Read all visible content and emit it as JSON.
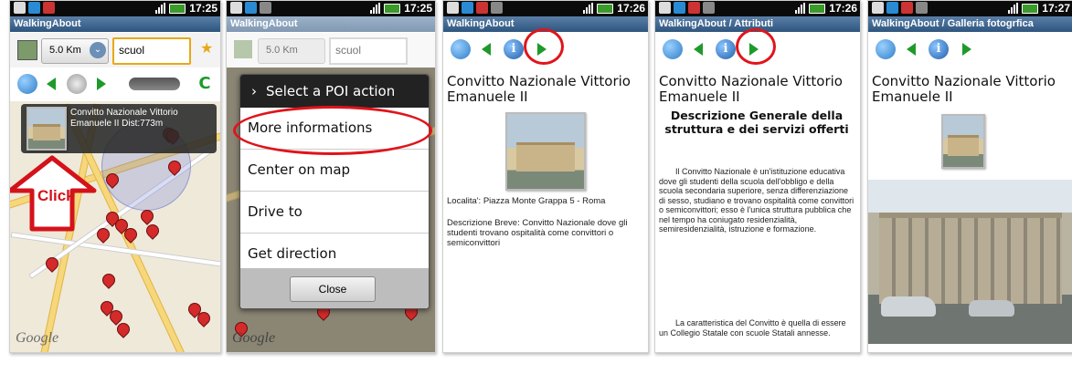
{
  "status": {
    "times": [
      "17:25",
      "17:25",
      "17:26",
      "17:26",
      "17:27"
    ]
  },
  "titles": [
    "WalkingAbout",
    "WalkingAbout",
    "WalkingAbout",
    "WalkingAbout / Attributi",
    "WalkingAbout / Galleria fotogrfica"
  ],
  "screen1": {
    "distance": "5.0 Km",
    "search_value": "scuol",
    "popup_title": "Convitto Nazionale Vittorio",
    "popup_line2": "Emanuele II Dist:773m",
    "click_label": "Click",
    "google": "Google"
  },
  "screen2": {
    "distance": "5.0 Km",
    "search_value": "scuol",
    "dialog_title": "Select a POI action",
    "actions": [
      "More informations",
      "Center on map",
      "Drive to",
      "Get direction"
    ],
    "close_label": "Close",
    "google": "Google"
  },
  "screen3": {
    "poi_name_1": "Convitto Nazionale Vittorio",
    "poi_name_2": "Emanuele II",
    "location": "Localita': Piazza Monte Grappa 5 - Roma",
    "description": "Descrizione  Breve: Convitto Nazionale dove gli studenti trovano ospitalità come convittori o semiconvittori"
  },
  "screen4": {
    "poi_name_1": "Convitto Nazionale Vittorio",
    "poi_name_2": "Emanuele II",
    "heading": "Descrizione Generale della struttura e dei servizi offerti",
    "paragraph1": "Il Convitto Nazionale è un'istituzione educativa dove gli studenti della scuola dell'obbligo e della scuola secondaria superiore, senza differenziazione di sesso, studiano e trovano ospitalità come convittori o semiconvittori; esso è l'unica struttura pubblica che nel tempo ha coniugato residenzialità, semiresidenzialità, istruzione e formazione.",
    "paragraph2": "La caratteristica del Convitto è quella di essere un Collegio Statale con scuole Statali annesse."
  },
  "screen5": {
    "poi_name_1": "Convitto Nazionale Vittorio",
    "poi_name_2": "Emanuele II"
  },
  "colors": {
    "titlebar": "#3b6591",
    "highlight": "#e0141b",
    "nav_green": "#1e9a2a"
  }
}
